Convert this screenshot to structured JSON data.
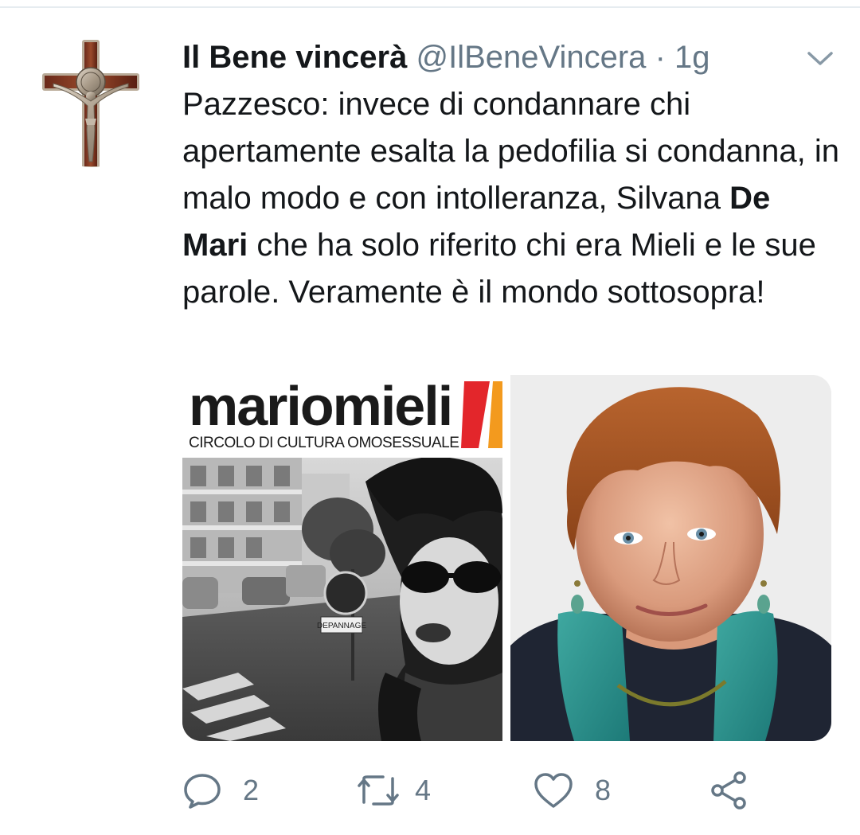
{
  "tweet": {
    "display_name": "Il Bene vincerà",
    "handle": "@IlBeneVincera",
    "separator": "·",
    "time": "1g",
    "text_part1": "Pazzesco: invece di condannare chi apertamente esalta la pedofilia si condanna, in malo modo e con intolleranza, Silvana ",
    "text_bold": "De Mari",
    "text_part2": " che ha solo riferito chi era Mieli e le sue parole. Veramente è il mondo sottosopra!"
  },
  "media": {
    "left_image": {
      "logo_word": "mariomieli",
      "logo_subtitle": "CIRCOLO DI CULTURA OMOSESSUALE",
      "sign_text": "DEPANNAGE"
    }
  },
  "actions": {
    "reply_count": "2",
    "retweet_count": "4",
    "like_count": "8"
  },
  "icons": {
    "avatar": "crucifix-avatar",
    "caret": "chevron-down-icon",
    "reply": "reply-icon",
    "retweet": "retweet-icon",
    "like": "heart-icon",
    "share": "share-icon"
  },
  "colors": {
    "text": "#14171a",
    "secondary_text": "#657786",
    "divider": "#e6ecf0",
    "logo_red": "#e3262b",
    "logo_orange": "#f39a1e"
  }
}
